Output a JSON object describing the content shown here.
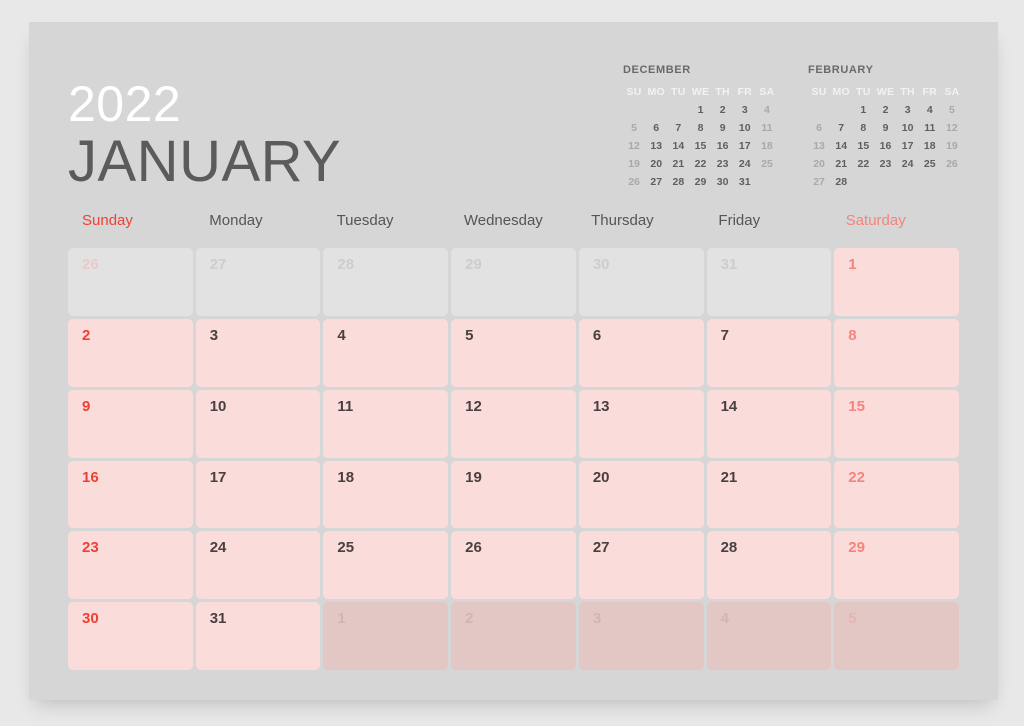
{
  "header": {
    "year": "2022",
    "month": "JANUARY"
  },
  "colors": {
    "accent_sunday": "#ef4036",
    "accent_saturday": "#f4847c",
    "cell_current": "#fadddb",
    "cell_prev_month": "#e2e2e2",
    "cell_next_month": "#e2c7c5",
    "card_background": "#d6d6d6",
    "page_background": "#e8e8e8",
    "month_title": "#5b5b5b"
  },
  "mini_calendars": [
    {
      "id": "december",
      "title": "DECEMBER",
      "dow": [
        "SU",
        "MO",
        "TU",
        "WE",
        "TH",
        "FR",
        "SA"
      ],
      "weeks": [
        [
          "",
          "",
          "",
          "1",
          "2",
          "3",
          "4"
        ],
        [
          "5",
          "6",
          "7",
          "8",
          "9",
          "10",
          "11"
        ],
        [
          "12",
          "13",
          "14",
          "15",
          "16",
          "17",
          "18"
        ],
        [
          "19",
          "20",
          "21",
          "22",
          "23",
          "24",
          "25"
        ],
        [
          "26",
          "27",
          "28",
          "29",
          "30",
          "31",
          ""
        ]
      ]
    },
    {
      "id": "february",
      "title": "FEBRUARY",
      "dow": [
        "SU",
        "MO",
        "TU",
        "WE",
        "TH",
        "FR",
        "SA"
      ],
      "weeks": [
        [
          "",
          "",
          "1",
          "2",
          "3",
          "4",
          "5"
        ],
        [
          "6",
          "7",
          "8",
          "9",
          "10",
          "11",
          "12"
        ],
        [
          "13",
          "14",
          "15",
          "16",
          "17",
          "18",
          "19"
        ],
        [
          "20",
          "21",
          "22",
          "23",
          "24",
          "25",
          "26"
        ],
        [
          "27",
          "28",
          "",
          "",
          "",
          "",
          ""
        ]
      ]
    }
  ],
  "weekday_headers": [
    "Sunday",
    "Monday",
    "Tuesday",
    "Wednesday",
    "Thursday",
    "Friday",
    "Saturday"
  ],
  "weeks": [
    [
      {
        "n": "26",
        "type": "prev"
      },
      {
        "n": "27",
        "type": "prev"
      },
      {
        "n": "28",
        "type": "prev"
      },
      {
        "n": "29",
        "type": "prev"
      },
      {
        "n": "30",
        "type": "prev"
      },
      {
        "n": "31",
        "type": "prev"
      },
      {
        "n": "1",
        "type": "current"
      }
    ],
    [
      {
        "n": "2",
        "type": "current"
      },
      {
        "n": "3",
        "type": "current"
      },
      {
        "n": "4",
        "type": "current"
      },
      {
        "n": "5",
        "type": "current"
      },
      {
        "n": "6",
        "type": "current"
      },
      {
        "n": "7",
        "type": "current"
      },
      {
        "n": "8",
        "type": "current"
      }
    ],
    [
      {
        "n": "9",
        "type": "current"
      },
      {
        "n": "10",
        "type": "current"
      },
      {
        "n": "11",
        "type": "current"
      },
      {
        "n": "12",
        "type": "current"
      },
      {
        "n": "13",
        "type": "current"
      },
      {
        "n": "14",
        "type": "current"
      },
      {
        "n": "15",
        "type": "current"
      }
    ],
    [
      {
        "n": "16",
        "type": "current"
      },
      {
        "n": "17",
        "type": "current"
      },
      {
        "n": "18",
        "type": "current"
      },
      {
        "n": "19",
        "type": "current"
      },
      {
        "n": "20",
        "type": "current"
      },
      {
        "n": "21",
        "type": "current"
      },
      {
        "n": "22",
        "type": "current"
      }
    ],
    [
      {
        "n": "23",
        "type": "current"
      },
      {
        "n": "24",
        "type": "current"
      },
      {
        "n": "25",
        "type": "current"
      },
      {
        "n": "26",
        "type": "current"
      },
      {
        "n": "27",
        "type": "current"
      },
      {
        "n": "28",
        "type": "current"
      },
      {
        "n": "29",
        "type": "current"
      }
    ],
    [
      {
        "n": "30",
        "type": "current"
      },
      {
        "n": "31",
        "type": "current"
      },
      {
        "n": "1",
        "type": "next"
      },
      {
        "n": "2",
        "type": "next"
      },
      {
        "n": "3",
        "type": "next"
      },
      {
        "n": "4",
        "type": "next"
      },
      {
        "n": "5",
        "type": "next"
      }
    ]
  ]
}
